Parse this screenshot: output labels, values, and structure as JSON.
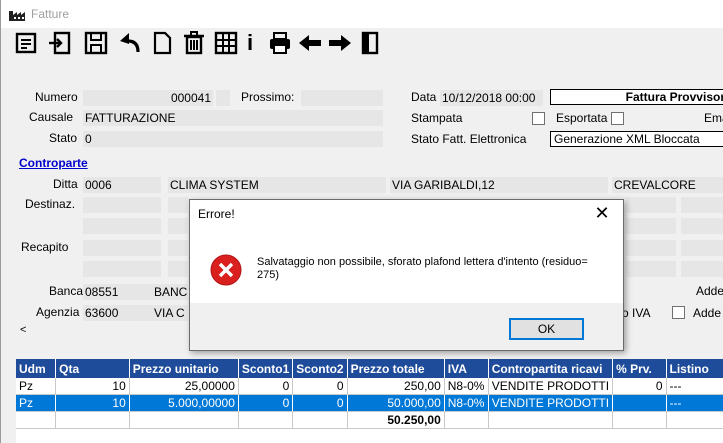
{
  "window": {
    "title": "Fatture"
  },
  "toolbar": {
    "buttons": [
      "list-icon",
      "open-icon",
      "save-icon",
      "undo-icon",
      "new-icon",
      "delete-icon",
      "grid-icon",
      "info-icon",
      "print-icon",
      "prev-icon",
      "next-icon",
      "exit-icon"
    ],
    "info_glyph": "i"
  },
  "form": {
    "numero_label": "Numero",
    "numero_value": "000041",
    "prossimo_label": "Prossimo:",
    "prossimo_value": "",
    "causale_label": "Causale",
    "causale_value": "FATTURAZIONE",
    "stato_label": "Stato",
    "stato_value": "0",
    "data_label": "Data",
    "data_value": "10/12/2018 00:00",
    "tipo_value": "Fattura Provvisoria",
    "stampata_label": "Stampata",
    "esportata_label": "Esportata",
    "email_label": "Emai",
    "stato_fe_label": "Stato Fatt. Elettronica",
    "stato_fe_value": "Generazione XML Bloccata",
    "controparte_label": "Controparte",
    "ditta_label": "Ditta",
    "ditta_code": "0006",
    "ditta_name": "CLIMA SYSTEM",
    "ditta_address": "VIA GARIBALDI,12",
    "ditta_city": "CREVALCORE",
    "destinaz_label": "Destinaz.",
    "recapito_label": "Recapito",
    "banca_label": "Banca",
    "banca_code": "08551",
    "banca_name": "BANC",
    "agenzia_label": "Agenzia",
    "agenzia_code": "63600",
    "agenzia_name": "VIA C",
    "adde_label_1": "Adde",
    "iva_label": "o IVA",
    "adde_label_2": "Adde"
  },
  "dialog": {
    "title": "Errore!",
    "close_glyph": "✕",
    "message": "Salvataggio non possibile, sforato plafond lettera d'intento (residuo= 275)",
    "ok_label": "OK"
  },
  "grid": {
    "columns": [
      "Udm",
      "Qta",
      "Prezzo unitario",
      "Sconto1",
      "Sconto2",
      "Prezzo totale",
      "IVA",
      "Contropartita ricavi",
      "% Prv.",
      "Listino"
    ],
    "rows": [
      [
        "Pz",
        "10",
        "25,00000",
        "0",
        "0",
        "250,00",
        "N8-0%",
        "VENDITE PRODOTTI",
        "0",
        "---"
      ],
      [
        "Pz",
        "10",
        "5.000,00000",
        "0",
        "0",
        "50.000,00",
        "N8-0%",
        "VENDITE PRODOTTI",
        "",
        "---"
      ]
    ],
    "total": "50.250,00"
  },
  "scroll": {
    "left_glyph": "<"
  }
}
